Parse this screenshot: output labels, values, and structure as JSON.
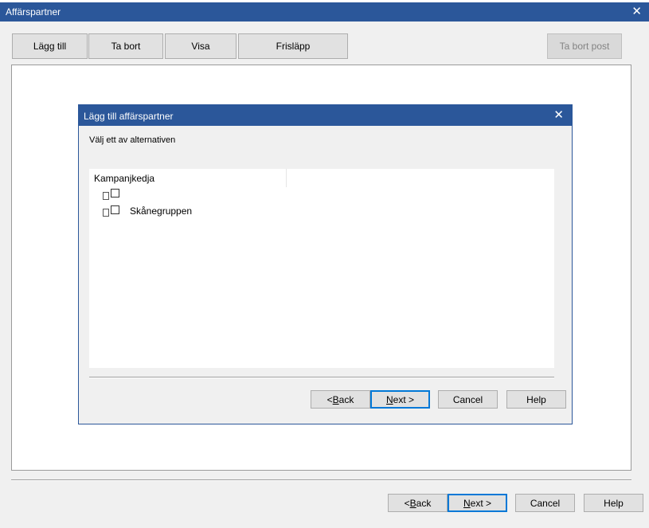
{
  "window": {
    "title": "Affärspartner",
    "close_glyph": "✕"
  },
  "toolbar": {
    "add_label": "Lägg till",
    "remove_label": "Ta bort",
    "show_label": "Visa",
    "release_label": "Frisläpp",
    "delete_post_label": "Ta bort post"
  },
  "dialog": {
    "title": "Lägg till affärspartner",
    "close_glyph": "✕",
    "instruction": "Välj ett av alternativen",
    "list": {
      "column_header": "Kampanjkedja",
      "items": [
        {
          "label": "",
          "checked": false
        },
        {
          "label": "Skånegruppen",
          "checked": false
        }
      ]
    },
    "buttons": {
      "back_prefix": "< ",
      "back_key": "B",
      "back_rest": "ack",
      "next_key": "N",
      "next_rest": "ext >",
      "cancel": "Cancel",
      "help": "Help"
    }
  },
  "footer": {
    "buttons": {
      "back_prefix": "< ",
      "back_key": "B",
      "back_rest": "ack",
      "next_key": "N",
      "next_rest": "ext >",
      "cancel": "Cancel",
      "help": "Help"
    }
  }
}
